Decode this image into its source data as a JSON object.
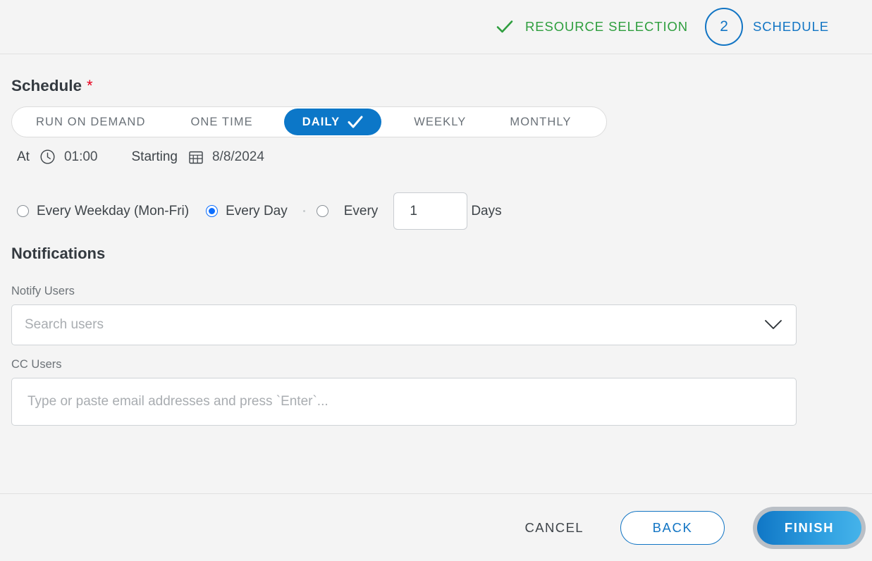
{
  "wizard": {
    "steps": [
      {
        "label": "RESOURCE SELECTION",
        "state": "completed",
        "icon": "check-icon"
      },
      {
        "label": "SCHEDULE",
        "state": "active",
        "number": "2"
      }
    ],
    "completed_color": "#2e9e3e",
    "active_color": "#1275c4"
  },
  "schedule": {
    "title": "Schedule",
    "required_marker": "*",
    "required_color": "#e8001d",
    "tabs": [
      {
        "label": "RUN ON DEMAND",
        "selected": false
      },
      {
        "label": "ONE TIME",
        "selected": false
      },
      {
        "label": "DAILY",
        "selected": true
      },
      {
        "label": "WEEKLY",
        "selected": false
      },
      {
        "label": "MONTHLY",
        "selected": false
      }
    ],
    "selected_tab_color": "#0c77c8",
    "at_label": "At",
    "time_value": "01:00",
    "time_icon": "clock-icon",
    "starting_label": "Starting",
    "date_value": "8/8/2024",
    "date_icon": "calendar-icon",
    "recurrence": {
      "options": [
        {
          "label": "Every Weekday (Mon-Fri)",
          "selected": false
        },
        {
          "label": "Every Day",
          "selected": true
        },
        {
          "label": "Every",
          "selected": false
        }
      ],
      "interval_value": "1",
      "interval_unit": "Days"
    }
  },
  "notifications": {
    "title": "Notifications",
    "notify_users": {
      "label": "Notify Users",
      "placeholder": "Search users",
      "value": "",
      "chevron_icon": "chevron-down-icon"
    },
    "cc_users": {
      "label": "CC Users",
      "placeholder": "Type or paste email addresses and press `Enter`...",
      "value": ""
    }
  },
  "footer": {
    "cancel_label": "CANCEL",
    "back_label": "BACK",
    "finish_label": "FINISH",
    "finish_focused": true
  }
}
